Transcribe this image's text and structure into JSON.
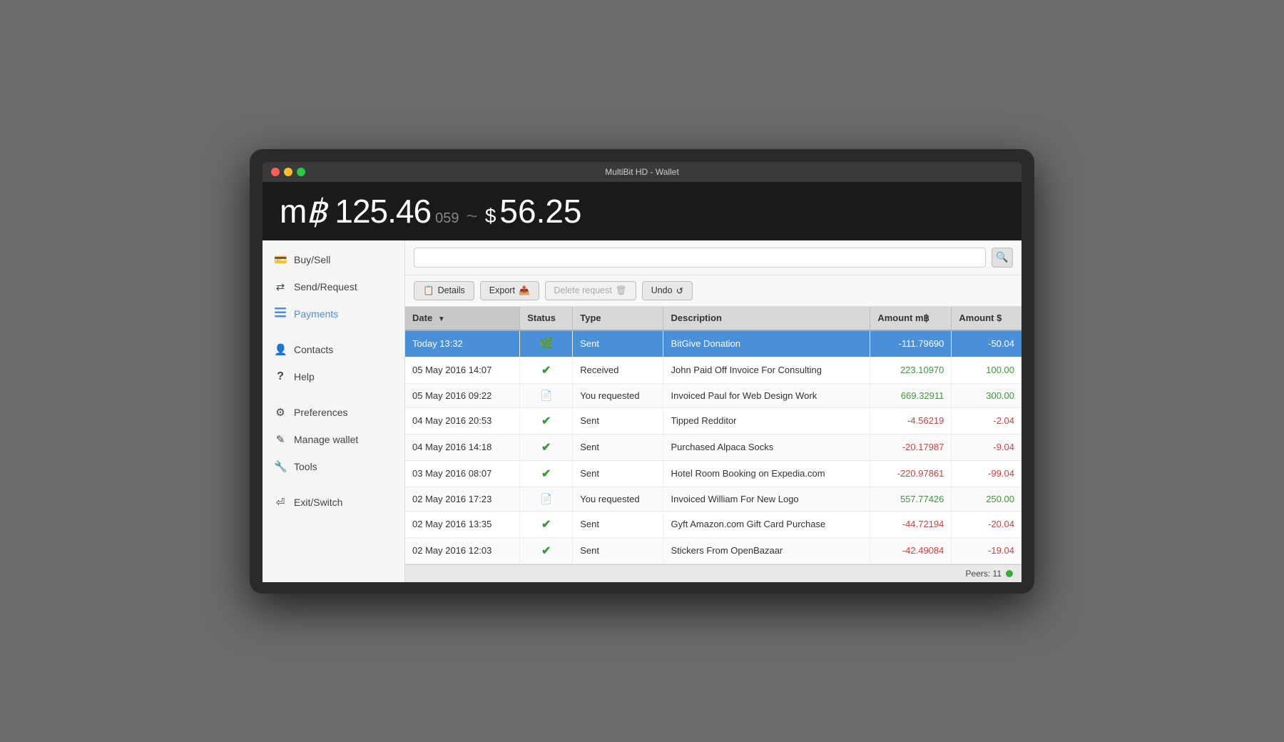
{
  "window": {
    "title": "MultiBit HD - Wallet"
  },
  "balance": {
    "mbtc_prefix": "m",
    "btc_symbol": "฿",
    "mbtc_main": "125.46",
    "mbtc_small": "059",
    "separator": "~",
    "usd_symbol": "$",
    "usd_value": "56.25"
  },
  "sidebar": {
    "items": [
      {
        "id": "buy-sell",
        "label": "Buy/Sell",
        "icon": "💳",
        "active": false
      },
      {
        "id": "send-request",
        "label": "Send/Request",
        "icon": "⇄",
        "active": false
      },
      {
        "id": "payments",
        "label": "Payments",
        "icon": "≡",
        "active": true
      },
      {
        "id": "contacts",
        "label": "Contacts",
        "icon": "👤",
        "active": false
      },
      {
        "id": "help",
        "label": "Help",
        "icon": "?",
        "active": false
      },
      {
        "id": "preferences",
        "label": "Preferences",
        "icon": "⚙",
        "active": false
      },
      {
        "id": "manage-wallet",
        "label": "Manage wallet",
        "icon": "✎",
        "active": false
      },
      {
        "id": "tools",
        "label": "Tools",
        "icon": "🔧",
        "active": false
      },
      {
        "id": "exit-switch",
        "label": "Exit/Switch",
        "icon": "⏎",
        "active": false
      }
    ]
  },
  "toolbar": {
    "search_placeholder": "",
    "search_icon": "🔍",
    "details_label": "Details",
    "export_label": "Export",
    "delete_request_label": "Delete request",
    "undo_label": "Undo"
  },
  "table": {
    "columns": [
      {
        "id": "date",
        "label": "Date",
        "sorted": true
      },
      {
        "id": "status",
        "label": "Status"
      },
      {
        "id": "type",
        "label": "Type"
      },
      {
        "id": "description",
        "label": "Description"
      },
      {
        "id": "amount_mbtc",
        "label": "Amount  m฿"
      },
      {
        "id": "amount_usd",
        "label": "Amount $"
      }
    ],
    "rows": [
      {
        "date": "Today 13:32",
        "status_type": "leaf",
        "status_icon": "🌿",
        "type": "Sent",
        "description": "BitGive Donation",
        "amount_mbtc": "-111.79690",
        "amount_usd": "-50.04",
        "selected": true
      },
      {
        "date": "05 May 2016 14:07",
        "status_type": "check",
        "status_icon": "✔",
        "type": "Received",
        "description": "John Paid Off Invoice For Consulting",
        "amount_mbtc": "223.10970",
        "amount_usd": "100.00",
        "selected": false
      },
      {
        "date": "05 May 2016 09:22",
        "status_type": "doc",
        "status_icon": "📄",
        "type": "You requested",
        "description": "Invoiced Paul for Web Design Work",
        "amount_mbtc": "669.32911",
        "amount_usd": "300.00",
        "selected": false
      },
      {
        "date": "04 May 2016 20:53",
        "status_type": "check",
        "status_icon": "✔",
        "type": "Sent",
        "description": "Tipped Redditor",
        "amount_mbtc": "-4.56219",
        "amount_usd": "-2.04",
        "selected": false
      },
      {
        "date": "04 May 2016 14:18",
        "status_type": "check",
        "status_icon": "✔",
        "type": "Sent",
        "description": "Purchased Alpaca Socks",
        "amount_mbtc": "-20.17987",
        "amount_usd": "-9.04",
        "selected": false
      },
      {
        "date": "03 May 2016 08:07",
        "status_type": "check",
        "status_icon": "✔",
        "type": "Sent",
        "description": "Hotel Room Booking on Expedia.com",
        "amount_mbtc": "-220.97861",
        "amount_usd": "-99.04",
        "selected": false
      },
      {
        "date": "02 May 2016 17:23",
        "status_type": "doc",
        "status_icon": "📄",
        "type": "You requested",
        "description": "Invoiced William For New Logo",
        "amount_mbtc": "557.77426",
        "amount_usd": "250.00",
        "selected": false
      },
      {
        "date": "02 May 2016 13:35",
        "status_type": "check",
        "status_icon": "✔",
        "type": "Sent",
        "description": "Gyft Amazon.com Gift Card Purchase",
        "amount_mbtc": "-44.72194",
        "amount_usd": "-20.04",
        "selected": false
      },
      {
        "date": "02 May 2016 12:03",
        "status_type": "check",
        "status_icon": "✔",
        "type": "Sent",
        "description": "Stickers From OpenBazaar",
        "amount_mbtc": "-42.49084",
        "amount_usd": "-19.04",
        "selected": false
      }
    ]
  },
  "bottom_bar": {
    "peers_label": "Peers: 11",
    "peers_color": "#3aaa3a"
  }
}
